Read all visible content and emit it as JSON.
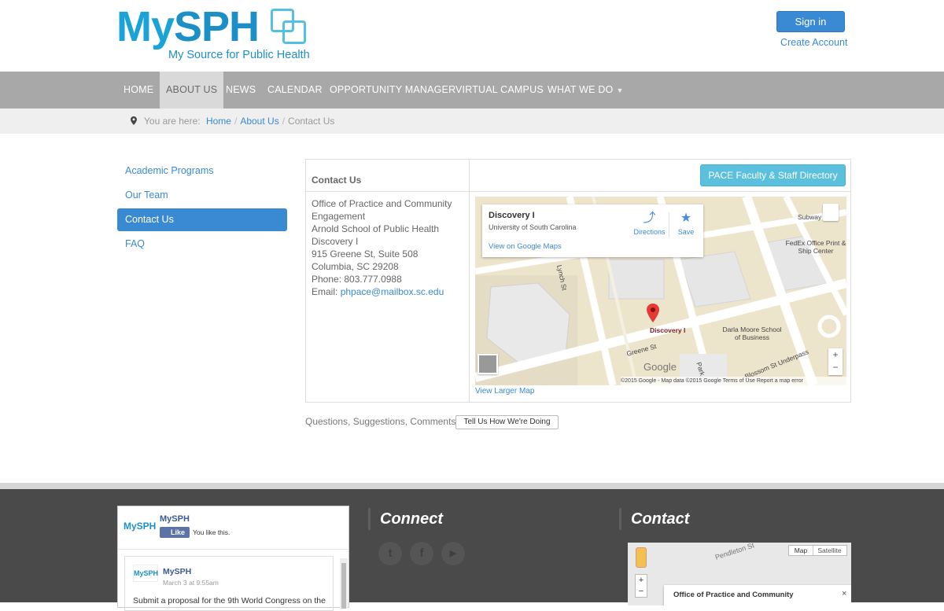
{
  "header": {
    "logo_my": "My",
    "logo_sph": "SPH",
    "logo_tagline": "My Source for Public Health",
    "signin_label": "Sign in",
    "create_account_label": "Create Account"
  },
  "nav": {
    "items": [
      {
        "label": "HOME"
      },
      {
        "label": "ABOUT US",
        "active": true
      },
      {
        "label": "NEWS"
      },
      {
        "label": "CALENDAR"
      },
      {
        "label": "OPPORTUNITY MANAGER"
      },
      {
        "label": "VIRTUAL CAMPUS"
      },
      {
        "label": "WHAT WE DO",
        "icon": "chevron-down-icon"
      }
    ]
  },
  "breadcrumb": {
    "prefix": "You are here:",
    "items": [
      "Home",
      "About Us",
      "Contact Us"
    ],
    "icon": "map-marker-icon"
  },
  "sidebar": {
    "items": [
      {
        "label": "Academic Programs"
      },
      {
        "label": "Our Team"
      },
      {
        "label": "Contact Us",
        "active": true
      },
      {
        "label": "FAQ"
      }
    ]
  },
  "contact": {
    "title": "Contact Us",
    "directory_button": "PACE Faculty & Staff Directory",
    "address_lines": [
      "Office of Practice and Community Engagement",
      "Arnold School of Public Health",
      "Discovery I",
      "915 Greene St, Suite 508",
      "Columbia, SC 29208",
      "Phone: 803.777.0988"
    ],
    "email_label": "Email: ",
    "email": "phpace@mailbox.sc.edu",
    "view_larger_map": "View Larger Map"
  },
  "map": {
    "place_name": "Discovery I",
    "place_sub": "University of South Carolina",
    "view_on_google": "View on Google Maps",
    "directions_label": "Directions",
    "save_label": "Save",
    "pin_label": "Discovery I",
    "labels": {
      "subway": "Subway",
      "fedex": "FedEx Office Print & Ship Center",
      "darla": "Darla Moore School of Business",
      "greene": "Greene St",
      "lynch": "Lynch St",
      "park": "Park",
      "underpass": "Blossom St Underpass"
    },
    "google": "Google",
    "credits": "©2015 Google - Map data ©2015 Google   Terms of Use   Report a map error",
    "zoom_in": "+",
    "zoom_out": "−",
    "colors": {
      "land": "#ede4cc",
      "road": "#ffffff",
      "pin": "#e53935"
    }
  },
  "feedback": {
    "question": "Questions, Suggestions, Comments?",
    "button": "Tell Us How We're Doing"
  },
  "footer": {
    "facebook": {
      "logo_text": "MySPH",
      "page_name": "MySPH",
      "like_label": "Like",
      "you_like": "You like this.",
      "post_name": "MySPH",
      "post_date": "March 3 at 9:55am",
      "post_text": "Submit a proposal for the 9th World Congress on the"
    },
    "connect_title": "Connect",
    "social": [
      {
        "icon": "twitter-icon",
        "glyph": "t"
      },
      {
        "icon": "facebook-icon",
        "glyph": "f"
      },
      {
        "icon": "youtube-icon",
        "glyph": "▶"
      }
    ],
    "contact_title": "Contact",
    "map": {
      "street": "Pendleton St",
      "map_tab": "Map",
      "satellite_tab": "Satellite",
      "zoom_in": "+",
      "zoom_out": "−",
      "card_text": "Office of Practice and Community",
      "close": "×"
    }
  }
}
